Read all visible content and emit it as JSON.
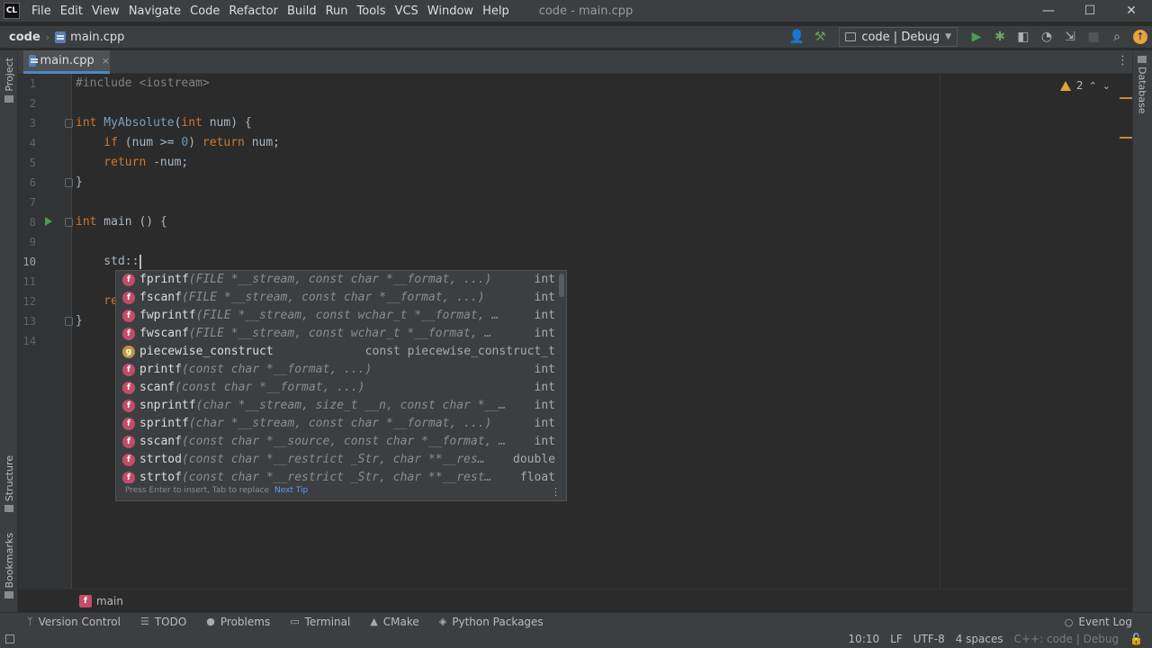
{
  "app": {
    "logo": "CL",
    "window_title": "code - main.cpp"
  },
  "menu": [
    "File",
    "Edit",
    "View",
    "Navigate",
    "Code",
    "Refactor",
    "Build",
    "Run",
    "Tools",
    "VCS",
    "Window",
    "Help"
  ],
  "window_controls": {
    "minimize": "—",
    "maximize": "☐",
    "close": "✕"
  },
  "nav": {
    "project": "code",
    "file": "main.cpp",
    "run_config": "code | Debug"
  },
  "tabs": [
    {
      "label": "main.cpp",
      "close": "×"
    }
  ],
  "side_tabs": {
    "left": [
      "Project",
      "Structure",
      "Bookmarks"
    ],
    "right": [
      "Database"
    ]
  },
  "inspection": {
    "warnings": "2"
  },
  "editor": {
    "line_numbers": [
      "1",
      "2",
      "3",
      "4",
      "5",
      "6",
      "7",
      "8",
      "9",
      "10",
      "11",
      "12",
      "13",
      "14"
    ],
    "current_line": "10",
    "lines": {
      "l1": "#include <iostream>",
      "l3_kw": "int",
      "l3_fn": " MyAbsolute",
      "l3_p1": "(",
      "l3_kw2": "int",
      "l3_p2": " num) {",
      "l4_kw": "    if",
      "l4_p1": " (num >= ",
      "l4_num": "0",
      "l4_p2": ") ",
      "l4_kw2": "return",
      "l4_p3": " num;",
      "l5_kw": "    return",
      "l5_p": " -num;",
      "l6": "}",
      "l8_kw": "int",
      "l8_p": " main () {",
      "l10": "    std::",
      "l12": "    re",
      "l13": "}"
    }
  },
  "completion": {
    "items": [
      {
        "icon": "f",
        "name": "fprintf",
        "sig": "(FILE *__stream, const char *__format, ...)",
        "type": "int"
      },
      {
        "icon": "f",
        "name": "fscanf",
        "sig": "(FILE *__stream, const char *__format, ...)",
        "type": "int"
      },
      {
        "icon": "f",
        "name": "fwprintf",
        "sig": "(FILE *__stream, const wchar_t *__format, …",
        "type": "int"
      },
      {
        "icon": "f",
        "name": "fwscanf",
        "sig": "(FILE *__stream, const wchar_t *__format, …",
        "type": "int"
      },
      {
        "icon": "g",
        "name": "piecewise_construct",
        "sig": "",
        "type": "const piecewise_construct_t"
      },
      {
        "icon": "f",
        "name": "printf",
        "sig": "(const char *__format, ...)",
        "type": "int"
      },
      {
        "icon": "f",
        "name": "scanf",
        "sig": "(const char *__format, ...)",
        "type": "int"
      },
      {
        "icon": "f",
        "name": "snprintf",
        "sig": "(char *__stream, size_t __n, const char *__…",
        "type": "int"
      },
      {
        "icon": "f",
        "name": "sprintf",
        "sig": "(char *__stream, const char *__format, ...)",
        "type": "int"
      },
      {
        "icon": "f",
        "name": "sscanf",
        "sig": "(const char *__source, const char *__format, …",
        "type": "int"
      },
      {
        "icon": "f",
        "name": "strtod",
        "sig": "(const char *__restrict _Str, char **__res…",
        "type": "double"
      },
      {
        "icon": "f",
        "name": "strtof",
        "sig": "(const char *__restrict _Str, char **__rest…",
        "type": "float"
      }
    ],
    "footer_hint": "Press Enter to insert, Tab to replace",
    "footer_tip": "Next Tip"
  },
  "breadcrumb": {
    "icon": "f",
    "function": "main"
  },
  "toolwindows": [
    "Version Control",
    "TODO",
    "Problems",
    "Terminal",
    "CMake",
    "Python Packages"
  ],
  "event_log": "Event Log",
  "status": {
    "position": "10:10",
    "line_sep": "LF",
    "encoding": "UTF-8",
    "indent": "4 spaces",
    "context": "C++: code | Debug"
  }
}
